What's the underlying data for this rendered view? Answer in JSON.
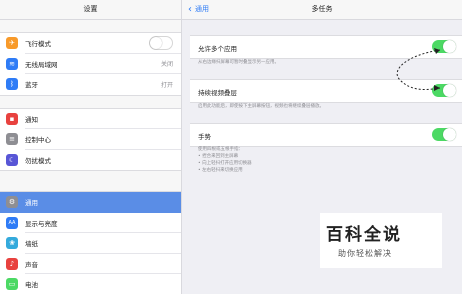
{
  "sidebar": {
    "title": "设置",
    "groups": [
      [
        {
          "label": "飞行模式",
          "icon": "airplane-icon",
          "color": "#f89a2a",
          "toggle": "off"
        },
        {
          "label": "无线局域网",
          "icon": "wifi-icon",
          "color": "#2f7cf6",
          "value": "关闭"
        },
        {
          "label": "蓝牙",
          "icon": "bluetooth-icon",
          "color": "#2f7cf6",
          "value": "打开"
        }
      ],
      [
        {
          "label": "通知",
          "icon": "notifications-icon",
          "color": "#e8423f"
        },
        {
          "label": "控制中心",
          "icon": "control-center-icon",
          "color": "#8e8e93"
        },
        {
          "label": "勿扰模式",
          "icon": "moon-icon",
          "color": "#5856d6"
        }
      ],
      [
        {
          "label": "通用",
          "icon": "gear-icon",
          "color": "#8e8e93",
          "active": true
        },
        {
          "label": "显示与亮度",
          "icon": "display-icon",
          "color": "#2f7cf6"
        },
        {
          "label": "墙纸",
          "icon": "wallpaper-icon",
          "color": "#34aadc"
        },
        {
          "label": "声音",
          "icon": "sound-icon",
          "color": "#e8423f"
        },
        {
          "label": "电池",
          "icon": "battery-icon",
          "color": "#4cd964"
        }
      ]
    ]
  },
  "main": {
    "back_label": "通用",
    "title": "多任务",
    "settings": [
      {
        "label": "允许多个应用",
        "toggle": "on",
        "note": "从右边缘扫屏幕可暂时叠显示另一应用。"
      },
      {
        "label": "持续视频叠层",
        "toggle": "on",
        "note": "启用此功能后，即使按下主屏幕按钮，视频也将继续叠层播放。"
      },
      {
        "label": "手势",
        "toggle": "on",
        "notes": [
          "使用四根或五根手指：",
          "• 捏合来回到主屏幕",
          "• 向上轻扫打开应用切换器",
          "• 左右轻扫来切换应用"
        ]
      }
    ]
  },
  "watermark": {
    "main": "百科全说",
    "sub": "助你轻松解决"
  },
  "colors": {
    "accent": "#2f7cf6",
    "toggle_on": "#4cd964",
    "active_row": "#5a8de6"
  }
}
